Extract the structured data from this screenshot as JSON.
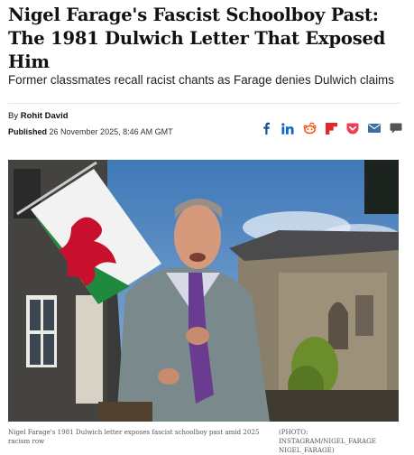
{
  "article": {
    "headline": "Nigel Farage's Fascist Schoolboy Past: The 1981 Dulwich Letter That Exposed Him",
    "subheadline": "Former classmates recall racist chants as Farage denies Dulwich claims",
    "byline_label": "By",
    "author": "Rohit David",
    "published_label": "Published",
    "published_date": "26 November 2025, 8:46 AM GMT"
  },
  "share": {
    "icons": [
      "facebook-icon",
      "linkedin-icon",
      "reddit-icon",
      "flipboard-icon",
      "pocket-icon",
      "email-icon",
      "comment-icon"
    ]
  },
  "image": {
    "caption": "Nigel Farage's 1981 Dulwich letter exposes fascist schoolboy past amid 2025 racism row",
    "credit": "(PHOTO: INSTAGRAM/NIGEL_FARAGE NIGEL_FARAGE)"
  },
  "colors": {
    "facebook": "#1b4f9c",
    "linkedin": "#0a66c2",
    "reddit": "#ff4500",
    "flipboard": "#e12828",
    "pocket": "#ef3f56",
    "email": "#3a6ea5",
    "comment": "#555555"
  }
}
